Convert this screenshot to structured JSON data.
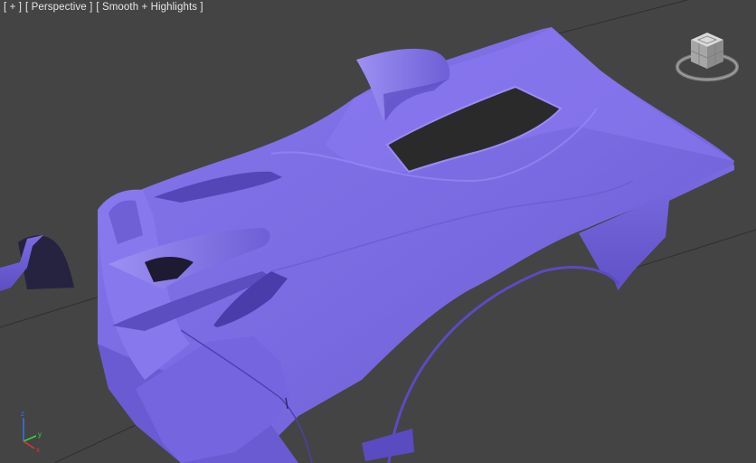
{
  "viewport": {
    "menu_plus": "[ + ]",
    "menu_view": "[ Perspective ]",
    "menu_shading": "[ Smooth + Highlights ]"
  },
  "axes": {
    "x": "x",
    "y": "y",
    "z": "z"
  },
  "colors": {
    "background": "#444444",
    "model": "#7f6fe6",
    "axis_x": "#d43a3a",
    "axis_y": "#3ccf3c",
    "axis_z": "#3c6fe0"
  },
  "icons": {
    "viewcube": "viewcube-icon",
    "axis_gizmo": "axis-tripod-icon"
  }
}
